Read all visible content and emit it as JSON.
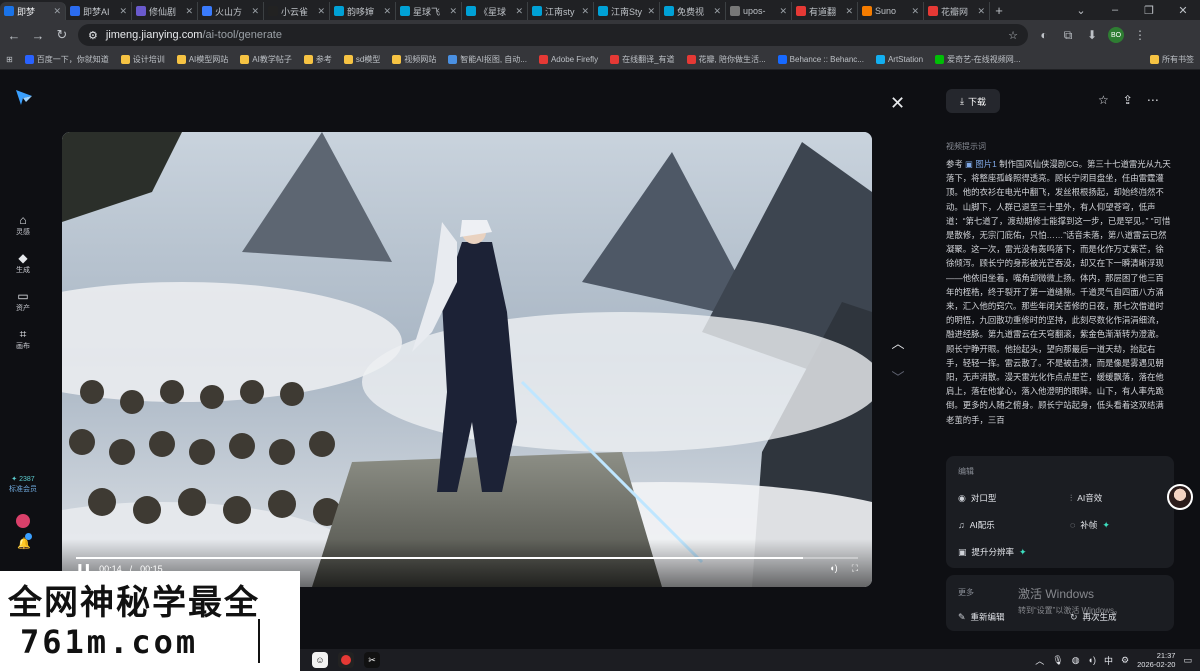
{
  "browser": {
    "tabs": [
      {
        "title": "即梦",
        "color": "#1a73e8",
        "active": true
      },
      {
        "title": "即梦AI",
        "color": "#2b6cf0"
      },
      {
        "title": "修仙剧",
        "color": "#6a5acd"
      },
      {
        "title": "火山方",
        "color": "#3a7bfd"
      },
      {
        "title": "小云雀",
        "color": "#222222"
      },
      {
        "title": "韵哆婶",
        "color": "#00a1d6"
      },
      {
        "title": "星球飞",
        "color": "#00a1d6"
      },
      {
        "title": "《星球",
        "color": "#00a1d6"
      },
      {
        "title": "江南sty",
        "color": "#00a1d6"
      },
      {
        "title": "江南Sty",
        "color": "#00a1d6"
      },
      {
        "title": "免费视",
        "color": "#00a1d6"
      },
      {
        "title": "upos-",
        "color": "#777777"
      },
      {
        "title": "有道翻",
        "color": "#e53935"
      },
      {
        "title": "Suno",
        "color": "#f57c00"
      },
      {
        "title": "花瓣网",
        "color": "#e53935"
      }
    ],
    "url_host": "jimeng.jianying.com",
    "url_path": "/ai-tool/generate",
    "profile_initials": "BO",
    "bookmarks": [
      {
        "label": "百度一下，你就知道",
        "color": "#2962ff"
      },
      {
        "label": "设计培训",
        "color": "#f6c343"
      },
      {
        "label": "AI模型网站",
        "color": "#f6c343"
      },
      {
        "label": "AI教学帖子",
        "color": "#f6c343"
      },
      {
        "label": "参考",
        "color": "#f6c343"
      },
      {
        "label": "sd模型",
        "color": "#f6c343"
      },
      {
        "label": "视频网站",
        "color": "#f6c343"
      },
      {
        "label": "智能AI抠图, 自动...",
        "color": "#4a90e2"
      },
      {
        "label": "Adobe Firefly",
        "color": "#e53935"
      },
      {
        "label": "在线翻译_有道",
        "color": "#e53935"
      },
      {
        "label": "花瓣, 陪你做生活...",
        "color": "#e53935"
      },
      {
        "label": "Behance :: Behanc...",
        "color": "#1769ff"
      },
      {
        "label": "ArtStation",
        "color": "#13aff0"
      },
      {
        "label": "爱奇艺-在线视频网...",
        "color": "#00be06"
      }
    ],
    "bookmarks_all": "所有书签"
  },
  "app": {
    "nav": [
      {
        "label": "灵感",
        "icon": "home-icon",
        "glyph": "⌂"
      },
      {
        "label": "生成",
        "icon": "generate-icon",
        "glyph": "◆"
      },
      {
        "label": "资产",
        "icon": "folder-icon",
        "glyph": "▭"
      },
      {
        "label": "画布",
        "icon": "canvas-icon",
        "glyph": "⌗"
      }
    ],
    "credits": "✦ 2387",
    "vip_label": "标准会员",
    "player": {
      "current_time": "00:14",
      "duration": "00:15",
      "progress": 0.93
    },
    "panel": {
      "download_label": "下载",
      "prompt_label": "视频提示词",
      "prompt_prefix": "参考",
      "prompt_ref": "图片1",
      "prompt_text": "制作国风仙侠漫剧CG。第三十七道雷光从九天落下，将整座孤峰照得透亮。顾长宁闭目盘坐，任由雷霆灌顶。他的衣衫在电光中翻飞，发丝根根扬起，却始终岿然不动。山脚下，人群已退至三十里外，有人仰望苍穹，低声道：“第七道了，渡劫期修士能撑到这一步，已是罕见。” “可惜是散修，无宗门庇佑，只怕……”话音未落，第八道雷云已然凝聚。这一次，雷光没有轰鸣落下，而是化作万丈紫芒，徐徐倾泻。顾长宁的身形被光芒吞没，却又在下一瞬清晰浮现——他依旧坐着，嘴角却微微上扬。体内，那层困了他三百年的桎梏，终于裂开了第一道缝隙。千道灵气自四面八方涌来，汇入他的窍穴。那些年闭关苦修的日夜，那七次借道时的明悟，九回散功重修时的坚持，此刻尽数化作涓涓细流，融进经脉。第九道雷云在天穹翻滚，紫金色渐渐转为澄澈。顾长宁睁开眼。他抬起头，望向那最后一道天劫，抬起右手，轻轻一挥。雷云散了。不是被击溃，而是像是雾遇见朝阳，无声消散。漫天雷光化作点点星芒，缓缓飘落，落在他肩上，落在他掌心，落入他澄明的眼眸。山下，有人率先跪倒。更多的人随之俯身。顾长宁站起身，低头看着这双结满老茧的手，三百",
      "edit_label": "编辑",
      "edit_actions": [
        {
          "label": "对口型",
          "icon": "lipsync-icon",
          "glyph": "◉",
          "plus": false
        },
        {
          "label": "AI音效",
          "icon": "sound-effect-icon",
          "glyph": "⫶",
          "plus": false
        },
        {
          "label": "AI配乐",
          "icon": "music-icon",
          "glyph": "♫",
          "plus": false
        },
        {
          "label": "补帧",
          "icon": "frame-interp-icon",
          "glyph": "◌",
          "plus": true
        },
        {
          "label": "提升分辨率",
          "icon": "upscale-icon",
          "glyph": "▣",
          "plus": true
        }
      ],
      "more_label": "更多",
      "more_actions": [
        {
          "label": "重新编辑",
          "icon": "re-edit-icon",
          "glyph": "✎"
        },
        {
          "label": "再次生成",
          "icon": "regenerate-icon",
          "glyph": "↻"
        }
      ]
    }
  },
  "windows_activation": {
    "title": "激活 Windows",
    "subtitle": "转到“设置”以激活 Windows。"
  },
  "taskbar": {
    "time": "21:37",
    "date": "2026-02-20",
    "ime": "中"
  },
  "site_watermark": {
    "line1": "全网神秘学最全",
    "line2": "761m.com"
  }
}
